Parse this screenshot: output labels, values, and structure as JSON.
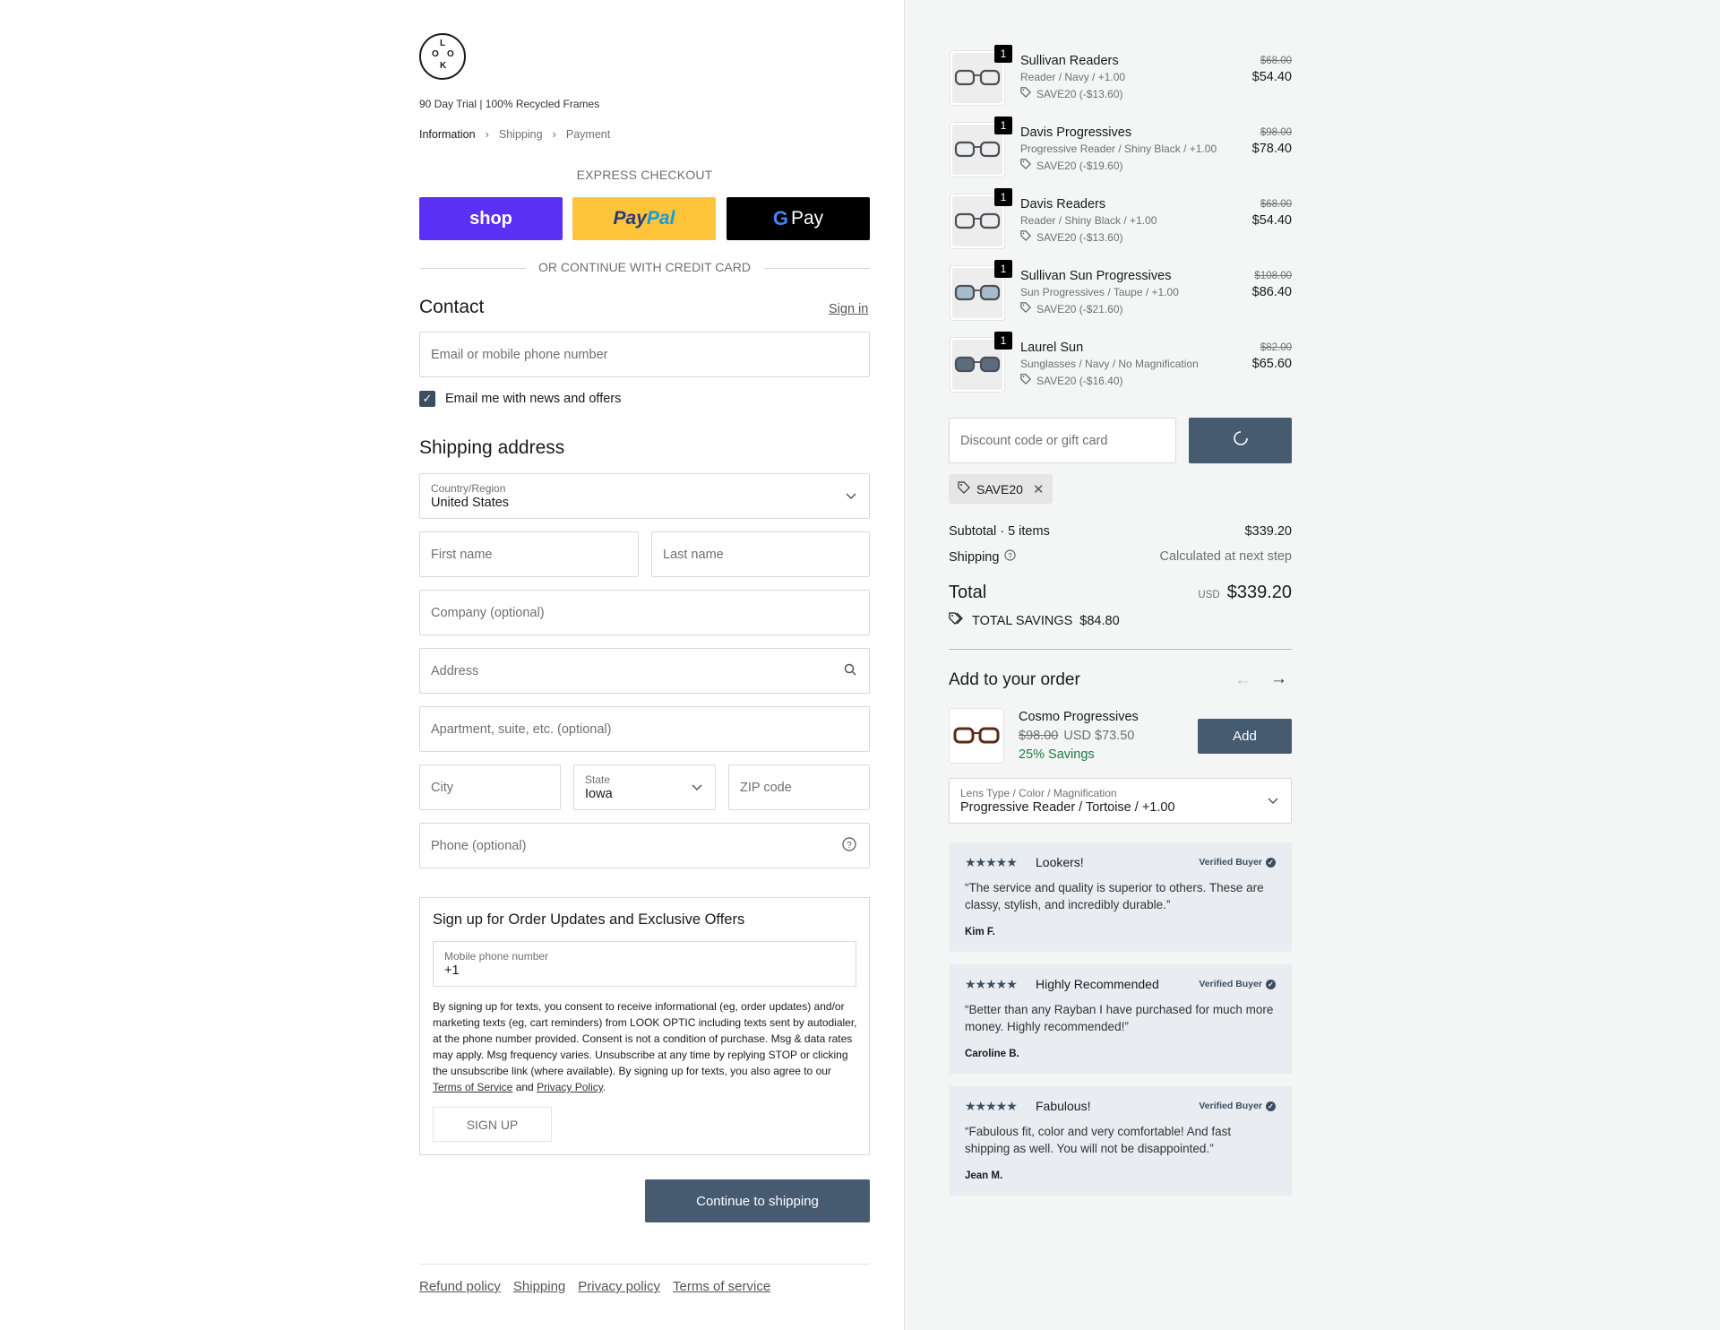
{
  "brand": {
    "logo_letters": [
      "L",
      "O",
      "O",
      "K"
    ],
    "tagline": "90 Day Trial | 100% Recycled Frames"
  },
  "breadcrumb": [
    "Information",
    "Shipping",
    "Payment"
  ],
  "express": {
    "title": "EXPRESS CHECKOUT",
    "shop_label": "shop",
    "paypal_pay": "Pay",
    "paypal_pal": "Pal",
    "gpay_g": "G",
    "gpay_label": "Pay"
  },
  "or_divider": "OR CONTINUE WITH CREDIT CARD",
  "contact": {
    "title": "Contact",
    "sign_in": "Sign in",
    "email_placeholder": "Email or mobile phone number",
    "newsletter_label": "Email me with news and offers",
    "newsletter_checked": true
  },
  "shipping": {
    "title": "Shipping address",
    "country_label": "Country/Region",
    "country_value": "United States",
    "first_name": "First name",
    "last_name": "Last name",
    "company": "Company (optional)",
    "address": "Address",
    "apartment": "Apartment, suite, etc. (optional)",
    "city": "City",
    "state_label": "State",
    "state_value": "Iowa",
    "zip": "ZIP code",
    "phone": "Phone (optional)"
  },
  "sms": {
    "title": "Sign up for Order Updates and Exclusive Offers",
    "phone_label": "Mobile phone number",
    "phone_value": "+1",
    "legal_text": "By signing up for texts, you consent to receive informational (eg, order updates) and/or marketing texts (eg, cart reminders) from LOOK OPTIC including texts sent by autodialer, at the phone number provided. Consent is not a condition of purchase. Msg & data rates may apply. Msg frequency varies. Unsubscribe at any time by replying STOP or clicking the unsubscribe link (where available). By signing up for texts, you also agree to our ",
    "terms_link": "Terms of Service",
    "and": " and ",
    "privacy_link": "Privacy Policy",
    "period": ".",
    "signup_button": "SIGN UP"
  },
  "continue_button": "Continue to shipping",
  "footer": [
    "Refund policy",
    "Shipping",
    "Privacy policy",
    "Terms of service"
  ],
  "cart": {
    "items": [
      {
        "name": "Sullivan Readers",
        "variant": "Reader / Navy / +1.00",
        "discount": "SAVE20 (-$13.60)",
        "old_price": "$68.00",
        "price": "$54.40",
        "qty": "1",
        "lens": "clear"
      },
      {
        "name": "Davis Progressives",
        "variant": "Progressive Reader / Shiny Black / +1.00",
        "discount": "SAVE20 (-$19.60)",
        "old_price": "$98.00",
        "price": "$78.40",
        "qty": "1",
        "lens": "clear"
      },
      {
        "name": "Davis Readers",
        "variant": "Reader / Shiny Black / +1.00",
        "discount": "SAVE20 (-$13.60)",
        "old_price": "$68.00",
        "price": "$54.40",
        "qty": "1",
        "lens": "clear"
      },
      {
        "name": "Sullivan Sun Progressives",
        "variant": "Sun Progressives / Taupe / +1.00",
        "discount": "SAVE20 (-$21.60)",
        "old_price": "$108.00",
        "price": "$86.40",
        "qty": "1",
        "lens": "light"
      },
      {
        "name": "Laurel Sun",
        "variant": "Sunglasses / Navy / No Magnification",
        "discount": "SAVE20 (-$16.40)",
        "old_price": "$82.00",
        "price": "$65.60",
        "qty": "1",
        "lens": "dark"
      }
    ],
    "discount_placeholder": "Discount code or gift card",
    "applied_code": "SAVE20",
    "subtotal_label": "Subtotal · 5 items",
    "subtotal_value": "$339.20",
    "shipping_label": "Shipping",
    "shipping_value": "Calculated at next step",
    "total_label": "Total",
    "currency": "USD",
    "total_value": "$339.20",
    "savings_label": "TOTAL SAVINGS",
    "savings_value": "$84.80"
  },
  "upsell": {
    "title": "Add to your order",
    "name": "Cosmo Progressives",
    "old_price": "$98.00",
    "price": "USD $73.50",
    "savings": "25% Savings",
    "add_button": "Add",
    "option_label": "Lens Type / Color / Magnification",
    "option_value": "Progressive Reader / Tortoise / +1.00"
  },
  "reviews": [
    {
      "stars": "★★★★★",
      "title": "Lookers!",
      "verified": "Verified Buyer",
      "text": "“The service and quality is superior to others. These are classy, stylish, and incredibly durable.”",
      "author": "Kim F."
    },
    {
      "stars": "★★★★★",
      "title": "Highly Recommended",
      "verified": "Verified Buyer",
      "text": "“Better than any Rayban I have purchased for much more money. Highly recommended!”",
      "author": "Caroline B."
    },
    {
      "stars": "★★★★★",
      "title": "Fabulous!",
      "verified": "Verified Buyer",
      "text": "“Fabulous fit, color and very comfortable! And fast shipping as well. You will not be disappointed.”",
      "author": "Jean M."
    }
  ],
  "colors": {
    "accent": "#465a70",
    "shop_purple": "#5a31f4",
    "paypal_yellow": "#ffc439",
    "savings_green": "#1e7a46"
  }
}
